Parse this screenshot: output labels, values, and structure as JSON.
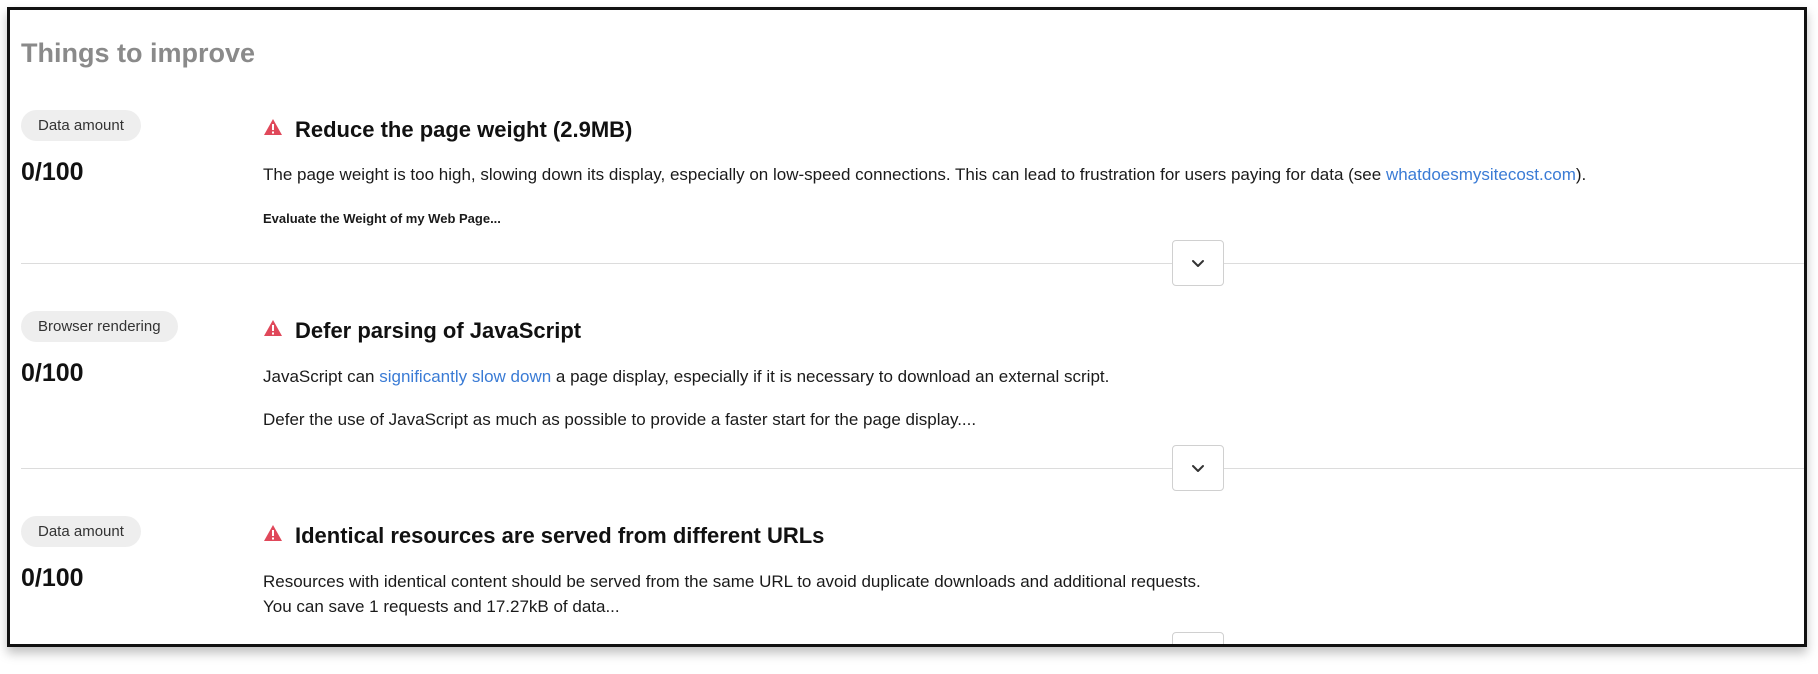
{
  "section": {
    "title": "Things to improve"
  },
  "items": [
    {
      "badge": "Data amount",
      "score": "0/100",
      "title": "Reduce the page weight (2.9MB)",
      "line1_pre": "The page weight is too high, slowing down its display, especially on low-speed connections. This can lead to frustration for users paying for data (see ",
      "line1_link": "whatdoesmysitecost.com",
      "line1_post": ").",
      "line2": "Evaluate the Weight of my Web Page..."
    },
    {
      "badge": "Browser rendering",
      "score": "0/100",
      "title": "Defer parsing of JavaScript",
      "line1_pre": "JavaScript can ",
      "line1_link": "significantly slow down",
      "line1_post": " a page display, especially if it is necessary to download an external script.",
      "line2": "Defer the use of JavaScript as much as possible to provide a faster start for the page display...."
    },
    {
      "badge": "Data amount",
      "score": "0/100",
      "title": "Identical resources are served from different URLs",
      "line1": "Resources with identical content should be served from the same URL to avoid duplicate downloads and additional requests.",
      "line2": "You can save 1 requests and 17.27kB of data..."
    }
  ],
  "icons": {
    "warning": "warning-triangle-icon",
    "expand": "chevron-down-icon"
  },
  "colors": {
    "warning": "#e0485a",
    "link": "#3a7bd5",
    "badge_bg": "#eeeeee",
    "title_gray": "#8a8a8a"
  }
}
